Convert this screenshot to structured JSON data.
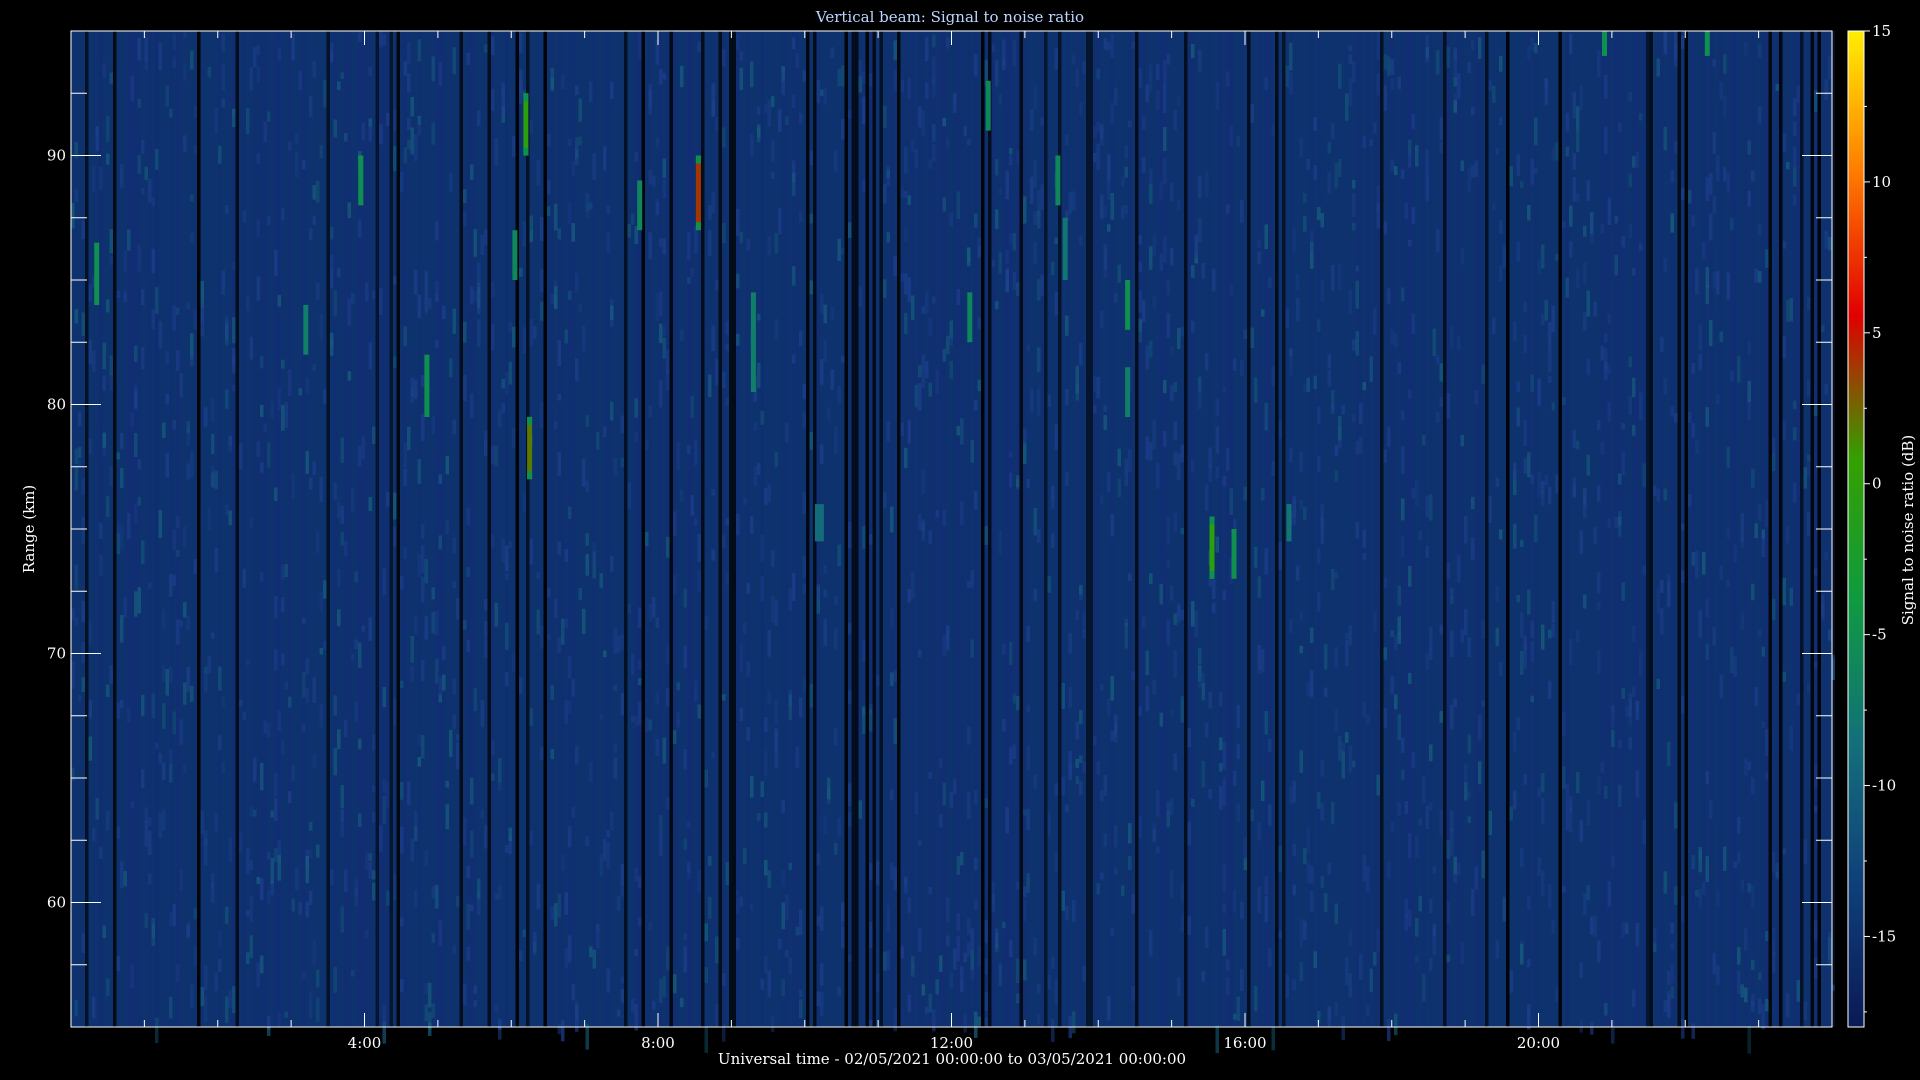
{
  "chart_data": {
    "type": "heatmap",
    "title": "Vertical beam: Signal to noise ratio",
    "xlabel": "Universal time - 02/05/2021 00:00:00 to 03/05/2021 00:00:00",
    "ylabel": "Range (km)",
    "colorbar_label": "Signal to noise ratio (dB)",
    "x_unit": "hours UT",
    "xlim": [
      0,
      24
    ],
    "ylim": [
      55,
      95
    ],
    "clim": [
      -18,
      15
    ],
    "x_ticks": [
      {
        "value": 4,
        "label": "4:00"
      },
      {
        "value": 8,
        "label": "8:00"
      },
      {
        "value": 12,
        "label": "12:00"
      },
      {
        "value": 16,
        "label": "16:00"
      },
      {
        "value": 20,
        "label": "20:00"
      }
    ],
    "y_ticks": [
      {
        "value": 60,
        "label": "60"
      },
      {
        "value": 70,
        "label": "70"
      },
      {
        "value": 80,
        "label": "80"
      },
      {
        "value": 90,
        "label": "90"
      }
    ],
    "colorbar_ticks": [
      {
        "value": 15,
        "label": "15"
      },
      {
        "value": 10,
        "label": "10"
      },
      {
        "value": 5,
        "label": "5"
      },
      {
        "value": 0,
        "label": "0"
      },
      {
        "value": -5,
        "label": "-5"
      },
      {
        "value": -10,
        "label": "-10"
      },
      {
        "value": -15,
        "label": "-15"
      }
    ],
    "colormap": [
      "#0a1a55",
      "#0f3f7a",
      "#12707a",
      "#0f9a40",
      "#33a000",
      "#e00000",
      "#ff7a00",
      "#ffee00"
    ],
    "background_snr_db": -15,
    "echoes": [
      {
        "time_h": 0.35,
        "range_top_km": 86.5,
        "range_bottom_km": 84,
        "snr_db": -5
      },
      {
        "time_h": 3.2,
        "range_top_km": 84,
        "range_bottom_km": 82,
        "snr_db": -7
      },
      {
        "time_h": 3.95,
        "range_top_km": 90,
        "range_bottom_km": 88,
        "snr_db": -5
      },
      {
        "time_h": 4.85,
        "range_top_km": 82,
        "range_bottom_km": 79.5,
        "snr_db": -5
      },
      {
        "time_h": 6.05,
        "range_top_km": 87,
        "range_bottom_km": 85,
        "snr_db": -6
      },
      {
        "time_h": 6.2,
        "range_top_km": 92.5,
        "range_bottom_km": 90,
        "snr_db": 0
      },
      {
        "time_h": 6.25,
        "range_top_km": 79.5,
        "range_bottom_km": 77,
        "snr_db": 2
      },
      {
        "time_h": 7.75,
        "range_top_km": 89,
        "range_bottom_km": 87,
        "snr_db": -6
      },
      {
        "time_h": 8.55,
        "range_top_km": 90,
        "range_bottom_km": 87,
        "snr_db": 4
      },
      {
        "time_h": 9.3,
        "range_top_km": 84.5,
        "range_bottom_km": 80.5,
        "snr_db": -7
      },
      {
        "time_h": 10.2,
        "range_top_km": 76,
        "range_bottom_km": 74.5,
        "snr_db": -9
      },
      {
        "time_h": 12.25,
        "range_top_km": 84.5,
        "range_bottom_km": 82.5,
        "snr_db": -6
      },
      {
        "time_h": 12.5,
        "range_top_km": 93,
        "range_bottom_km": 91,
        "snr_db": -6
      },
      {
        "time_h": 13.45,
        "range_top_km": 90,
        "range_bottom_km": 88,
        "snr_db": -6
      },
      {
        "time_h": 13.55,
        "range_top_km": 87.5,
        "range_bottom_km": 85,
        "snr_db": -8
      },
      {
        "time_h": 14.4,
        "range_top_km": 85,
        "range_bottom_km": 83,
        "snr_db": -5
      },
      {
        "time_h": 14.4,
        "range_top_km": 81.5,
        "range_bottom_km": 79.5,
        "snr_db": -7
      },
      {
        "time_h": 15.55,
        "range_top_km": 75.5,
        "range_bottom_km": 73,
        "snr_db": 0
      },
      {
        "time_h": 15.85,
        "range_top_km": 75,
        "range_bottom_km": 73,
        "snr_db": -5
      },
      {
        "time_h": 16.6,
        "range_top_km": 76,
        "range_bottom_km": 74.5,
        "snr_db": -8
      },
      {
        "time_h": 20.9,
        "range_top_km": 95,
        "range_bottom_km": 94,
        "snr_db": -5
      },
      {
        "time_h": 22.3,
        "range_top_km": 95,
        "range_bottom_km": 94,
        "snr_db": -5
      }
    ]
  }
}
